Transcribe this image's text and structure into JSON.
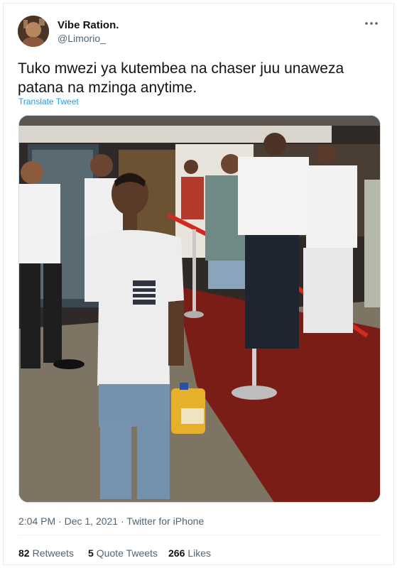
{
  "tweet": {
    "author_name": "Vibe Ration.",
    "author_handle": "@Limorio_",
    "text": "Tuko mwezi ya kutembea na chaser juu unaweza patana na mzinga anytime.",
    "translate_label": "Translate Tweet",
    "more_icon": "more-horizontal-icon",
    "time": "2:04 PM",
    "date": "Dec 1, 2021",
    "source": "Twitter for iPhone",
    "meta_separator": " · "
  },
  "stats": {
    "retweets_count": "82",
    "retweets_label": "Retweets",
    "quotes_count": "5",
    "quotes_label": "Quote Tweets",
    "likes_count": "266",
    "likes_label": "Likes"
  },
  "colors": {
    "link": "#1d9bf0",
    "secondary_text": "#536471",
    "primary_text": "#0f1419",
    "border": "#e6ecf0"
  }
}
